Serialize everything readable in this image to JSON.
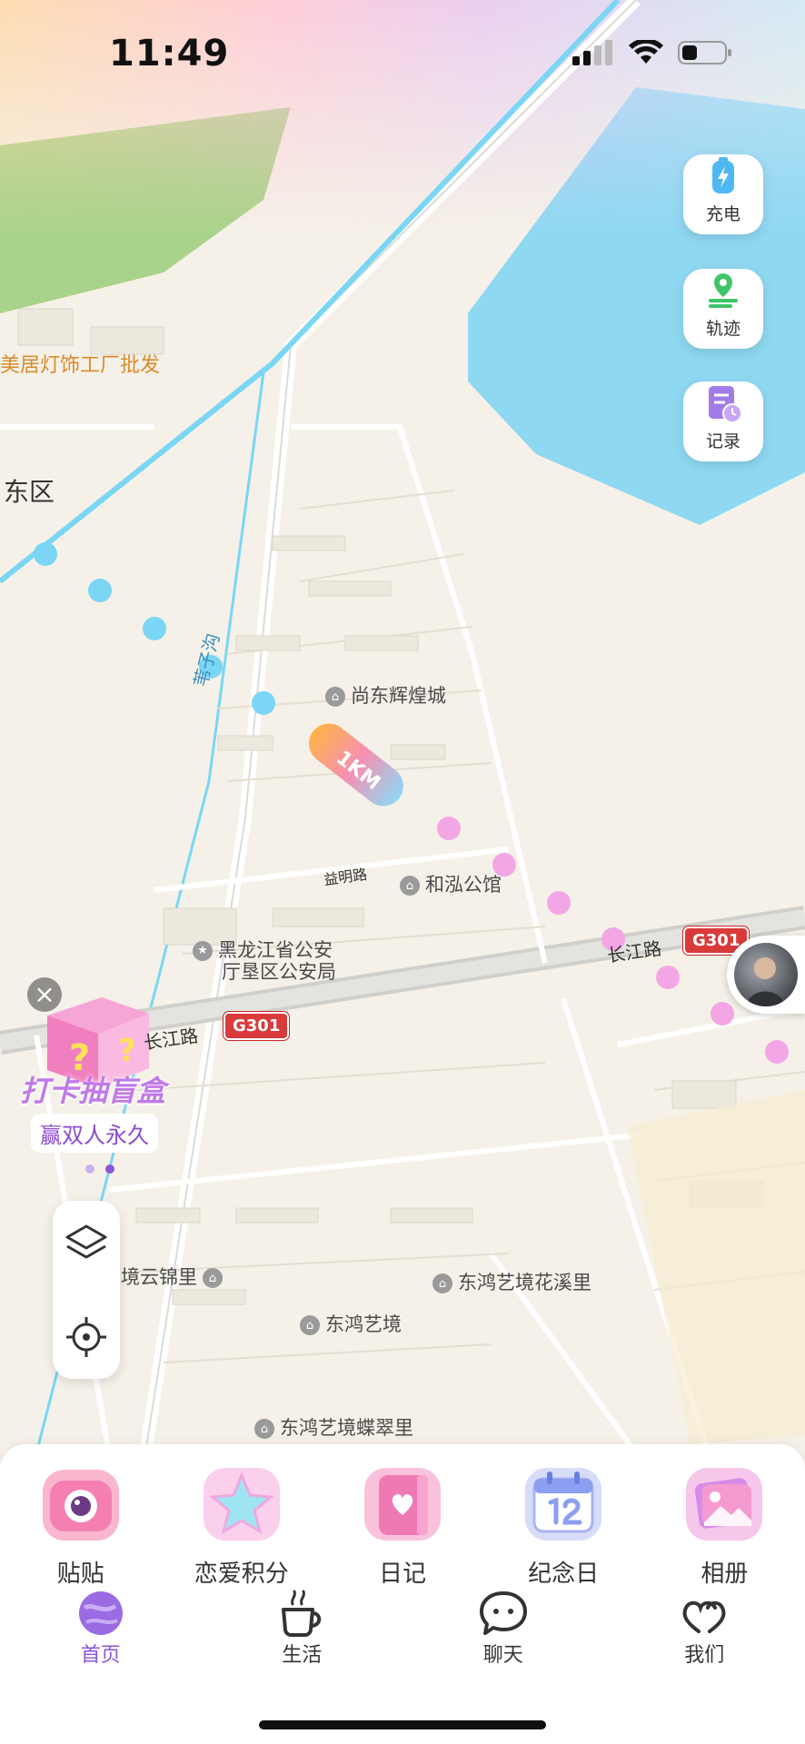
{
  "status": {
    "time": "11:49"
  },
  "map": {
    "labels": {
      "shop": "美居灯饰工厂批发",
      "district": "东区",
      "canal": "苇子沟",
      "poi_shangdong": "尚东辉煌城",
      "poi_hehong": "和泓公馆",
      "poi_police_line1": "黑龙江省公安",
      "poi_police_line2": "厅垦区公安局",
      "road_yiming": "益明路",
      "road_changjiang_right": "长江路",
      "road_changjiang_left": "长江路",
      "poi_jinli": "东鸿艺境云锦里",
      "poi_xili": "东鸿艺境花溪里",
      "poi_yijing": "东鸿艺境",
      "poi_cuili": "东鸿艺境蝶翠里",
      "distance_badge": "1KM"
    },
    "shields": [
      "G301",
      "G301"
    ]
  },
  "side_buttons": [
    {
      "label": "充电",
      "icon": "battery-charge-icon"
    },
    {
      "label": "轨迹",
      "icon": "track-pin-icon"
    },
    {
      "label": "记录",
      "icon": "record-doc-icon"
    }
  ],
  "promo": {
    "title": "打卡抽盲盒",
    "subtitle": "赢双人永久",
    "close": "×"
  },
  "shortcuts": [
    {
      "label": "贴贴",
      "icon": "camera-icon"
    },
    {
      "label": "恋爱积分",
      "icon": "star-icon"
    },
    {
      "label": "日记",
      "icon": "diary-icon"
    },
    {
      "label": "纪念日",
      "icon": "calendar-icon"
    },
    {
      "label": "相册",
      "icon": "album-icon"
    }
  ],
  "tabs": [
    {
      "label": "首页",
      "icon": "planet-icon",
      "active": true
    },
    {
      "label": "生活",
      "icon": "coffee-cup-icon",
      "active": false
    },
    {
      "label": "聊天",
      "icon": "chat-bubble-icon",
      "active": false
    },
    {
      "label": "我们",
      "icon": "hearts-icon",
      "active": false
    }
  ],
  "colors": {
    "accent": "#8b55d8",
    "water": "#8fd8f2",
    "track_blue": "#7ad6f4",
    "track_pink": "#f3a6e6",
    "shield_red": "#d93a3a"
  }
}
